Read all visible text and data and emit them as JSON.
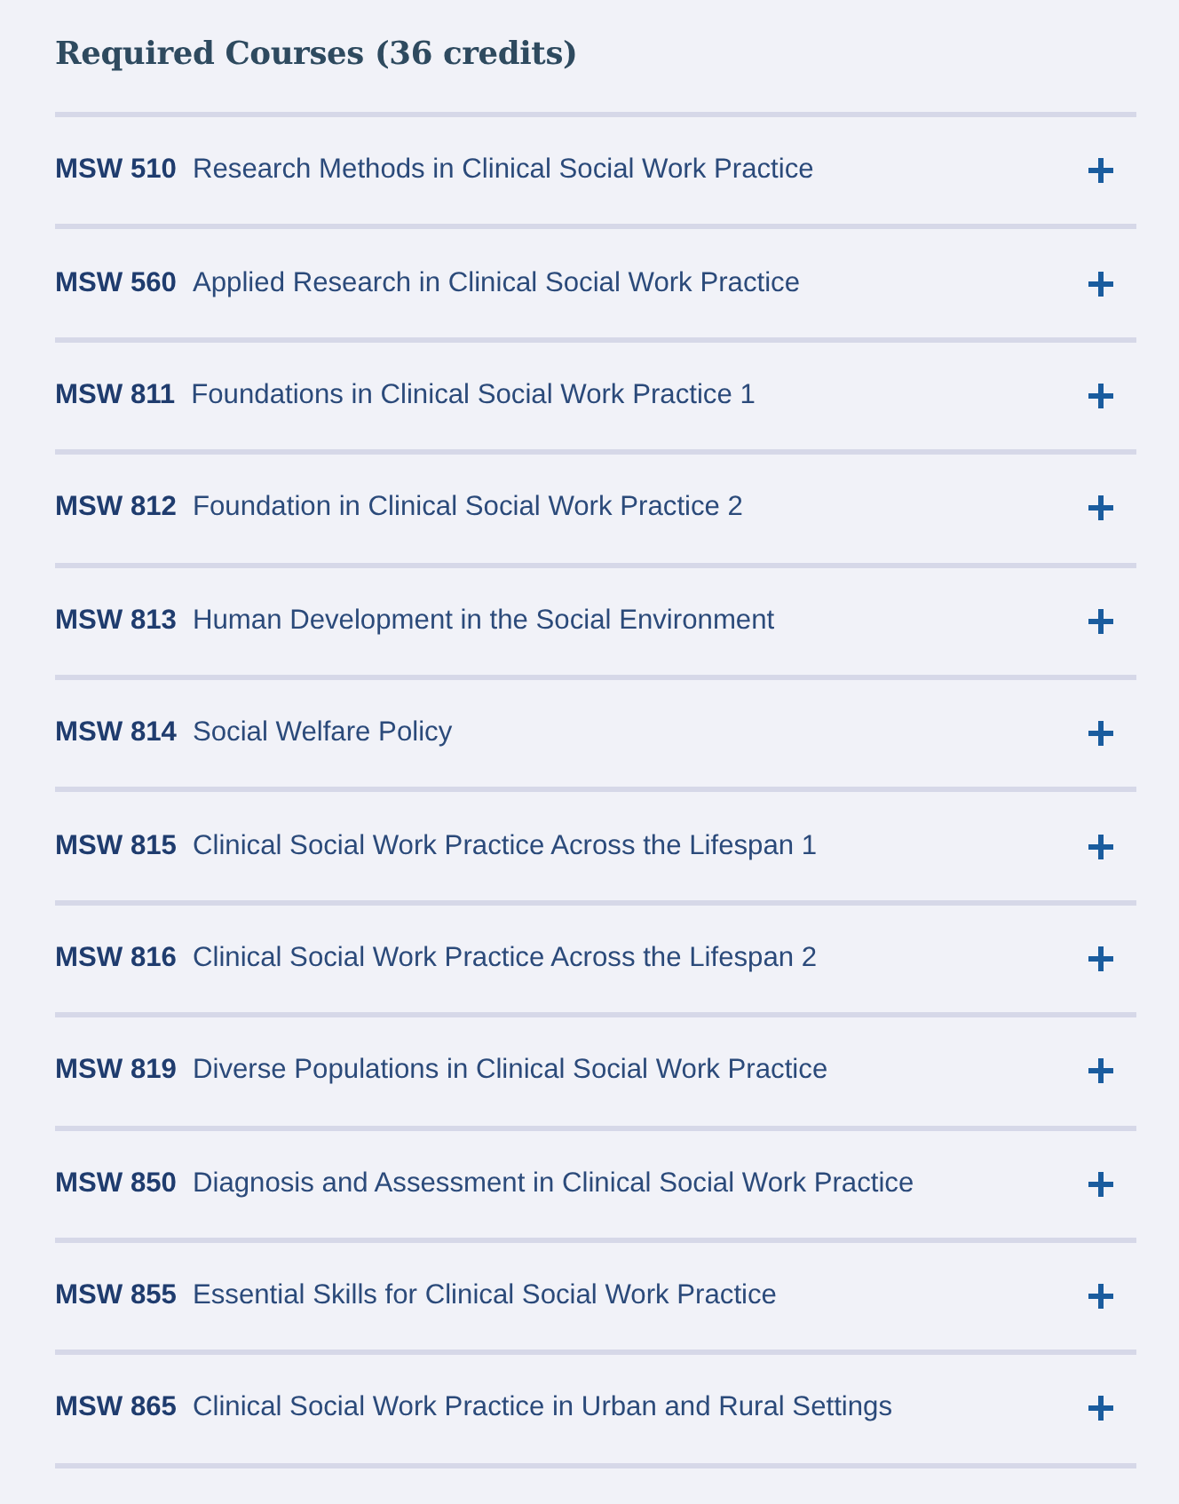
{
  "heading": "Required Courses (36 credits)",
  "courses": [
    {
      "code": "MSW 510",
      "title": "Research Methods in Clinical Social Work Practice",
      "expanded": false
    },
    {
      "code": "MSW 560",
      "title": "Applied Research in Clinical Social Work Practice",
      "expanded": false
    },
    {
      "code": "MSW 811",
      "title": "Foundations in Clinical Social Work Practice 1",
      "expanded": false
    },
    {
      "code": "MSW 812",
      "title": "Foundation in Clinical Social Work Practice 2",
      "expanded": false
    },
    {
      "code": "MSW 813",
      "title": "Human Development in the Social Environment",
      "expanded": false
    },
    {
      "code": "MSW 814",
      "title": "Social Welfare Policy",
      "expanded": false
    },
    {
      "code": "MSW 815",
      "title": "Clinical Social Work Practice Across the Lifespan 1",
      "expanded": false
    },
    {
      "code": "MSW 816",
      "title": "Clinical Social Work Practice Across the Lifespan 2",
      "expanded": false
    },
    {
      "code": "MSW 819",
      "title": "Diverse Populations in Clinical Social Work Practice",
      "expanded": false
    },
    {
      "code": "MSW 850",
      "title": "Diagnosis and Assessment in Clinical Social Work Practice",
      "expanded": false
    },
    {
      "code": "MSW 855",
      "title": "Essential Skills for Clinical Social Work Practice",
      "expanded": false
    },
    {
      "code": "MSW 865",
      "title": "Clinical Social Work Practice in Urban and Rural Settings",
      "expanded": false
    }
  ]
}
